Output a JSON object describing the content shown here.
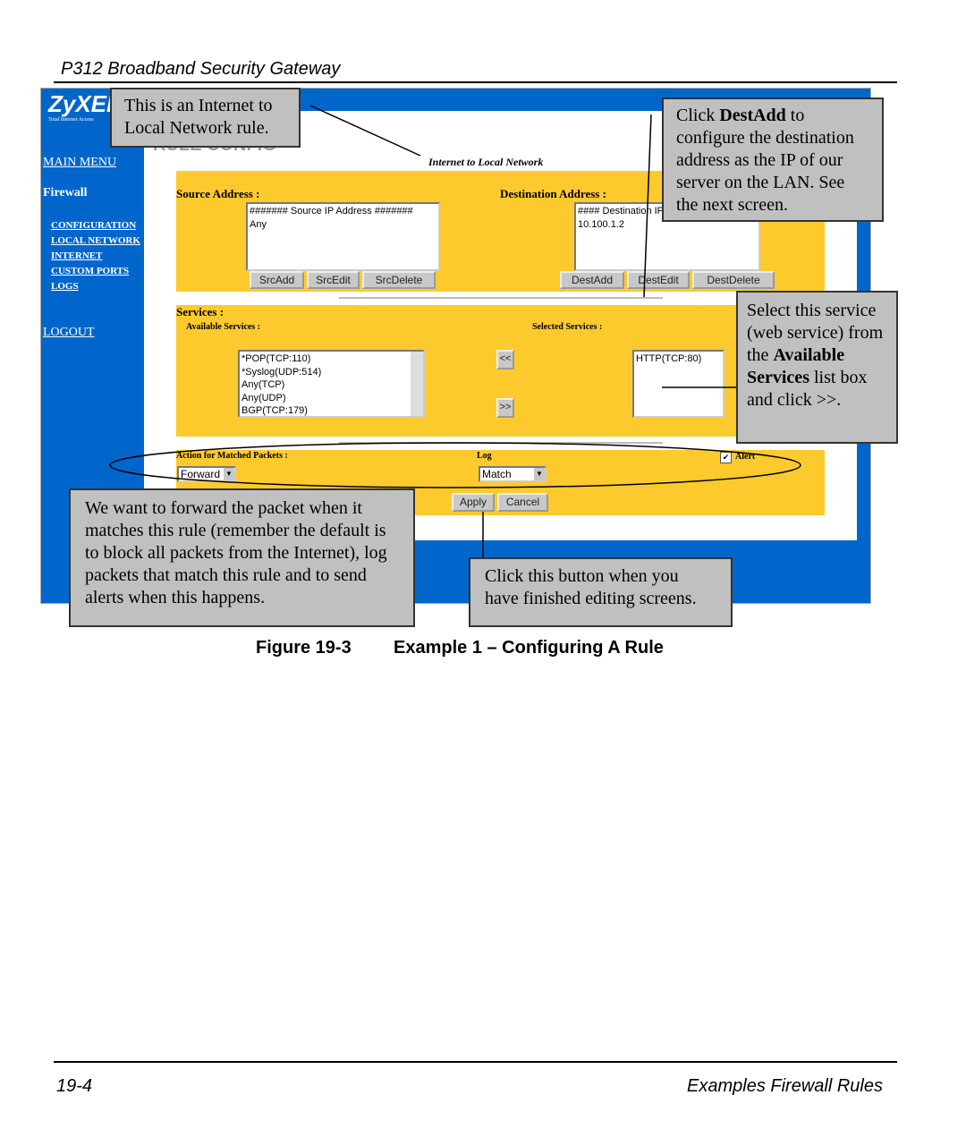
{
  "page": {
    "header": "P312  Broadband Security Gateway",
    "footer_left": "19-4",
    "footer_right": "Examples Firewall Rules",
    "figure_number": "Figure 19-3",
    "figure_title": "Example 1 – Configuring A Rule"
  },
  "screenshot": {
    "logo": "ZyXEL",
    "logo_tagline": "Total Internet Access",
    "sidebar": {
      "main_menu": "MAIN MENU",
      "section": "Firewall",
      "items": [
        "CONFIGURATION",
        "LOCAL NETWORK",
        "INTERNET",
        "CUSTOM PORTS",
        "LOGS"
      ],
      "logout": "LOGOUT"
    },
    "page_title": "RULE CONFIG",
    "rule_direction": "Internet to Local Network",
    "source": {
      "label": "Source Address :",
      "list": [
        "####### Source IP Address #######",
        "Any"
      ],
      "buttons": [
        "SrcAdd",
        "SrcEdit",
        "SrcDelete"
      ]
    },
    "destination": {
      "label": "Destination Address :",
      "list": [
        "#### Destination IP Address ####",
        "10.100.1.2"
      ],
      "buttons": [
        "DestAdd",
        "DestEdit",
        "DestDelete"
      ]
    },
    "services": {
      "label": "Services :",
      "available_label": "Available Services :",
      "selected_label": "Selected Services :",
      "available": [
        "*POP(TCP:110)",
        "*Syslog(UDP:514)",
        "Any(TCP)",
        "Any(UDP)",
        "BGP(TCP:179)"
      ],
      "selected": [
        "HTTP(TCP:80)"
      ],
      "remove_button": "<<",
      "add_button": ">>"
    },
    "action": {
      "label": "Action for Matched Packets :",
      "value": "Forward",
      "log_label": "Log",
      "log_value": "Match",
      "alert_label": "Alert",
      "alert_checked": true
    },
    "apply": "Apply",
    "cancel": "Cancel",
    "colors": {
      "blue": "#0066cc",
      "yellow": "#fdca2e"
    }
  },
  "callouts": {
    "c1": "This is an Internet to Local Network rule.",
    "c2_pre": "Click ",
    "c2_bold": "DestAdd",
    "c2_post": " to configure the destination address as the IP of our server on the LAN. See the next screen.",
    "c3_pre": "Select this service (web service) from the ",
    "c3_bold": "Available Services",
    "c3_post": " list box and click >>.",
    "c4": "We want to forward the packet when it matches this rule (remember the default is to block all packets from the Internet), log packets that match this rule and to send alerts when this happens.",
    "c5": "Click this button when you have finished editing screens."
  }
}
